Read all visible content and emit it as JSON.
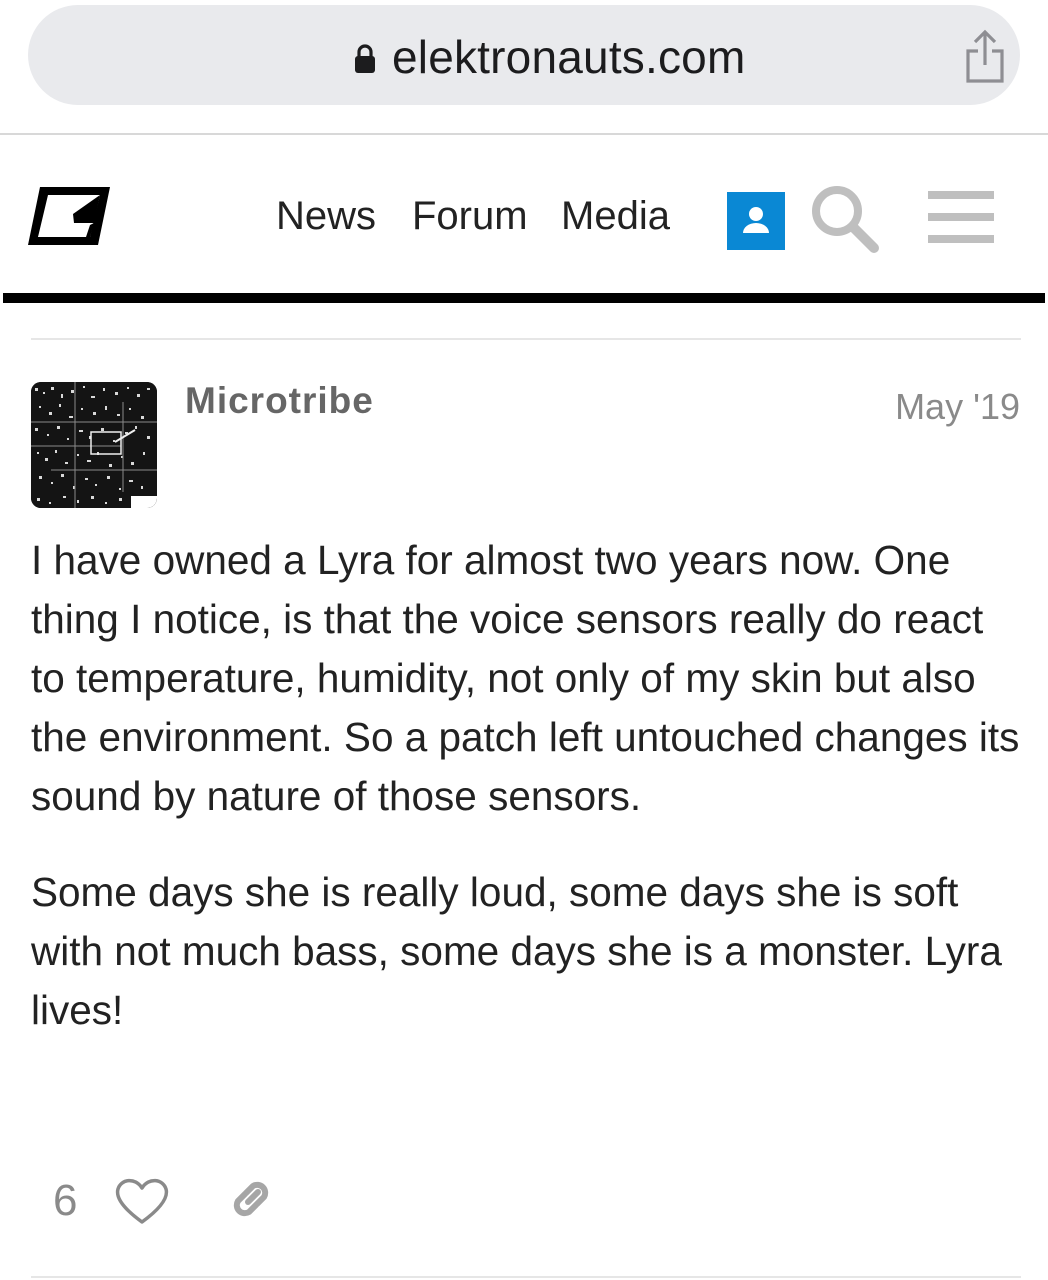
{
  "browser": {
    "url": "elektronauts.com",
    "icons": [
      "lock-icon",
      "share-icon"
    ]
  },
  "header": {
    "logo": "elektronauts-logo",
    "nav": [
      {
        "label": "News"
      },
      {
        "label": "Forum"
      },
      {
        "label": "Media"
      }
    ],
    "icons": [
      "user-icon",
      "search-icon",
      "hamburger-menu-icon"
    ],
    "accent_color": "#0a88d4"
  },
  "post": {
    "username": "Microtribe",
    "date": "May '19",
    "paragraphs": [
      "I have owned a Lyra for almost two years now. One thing I notice, is that the voice sensors really do react to temperature, humidity, not only of my skin but also the environment. So a patch left untouched changes its sound by nature of those sensors.",
      "Some days she is really loud, some days she is soft with not much bass, some days she is a monster. Lyra lives!"
    ],
    "likes": "6",
    "icons": [
      "heart-icon",
      "link-icon"
    ]
  }
}
